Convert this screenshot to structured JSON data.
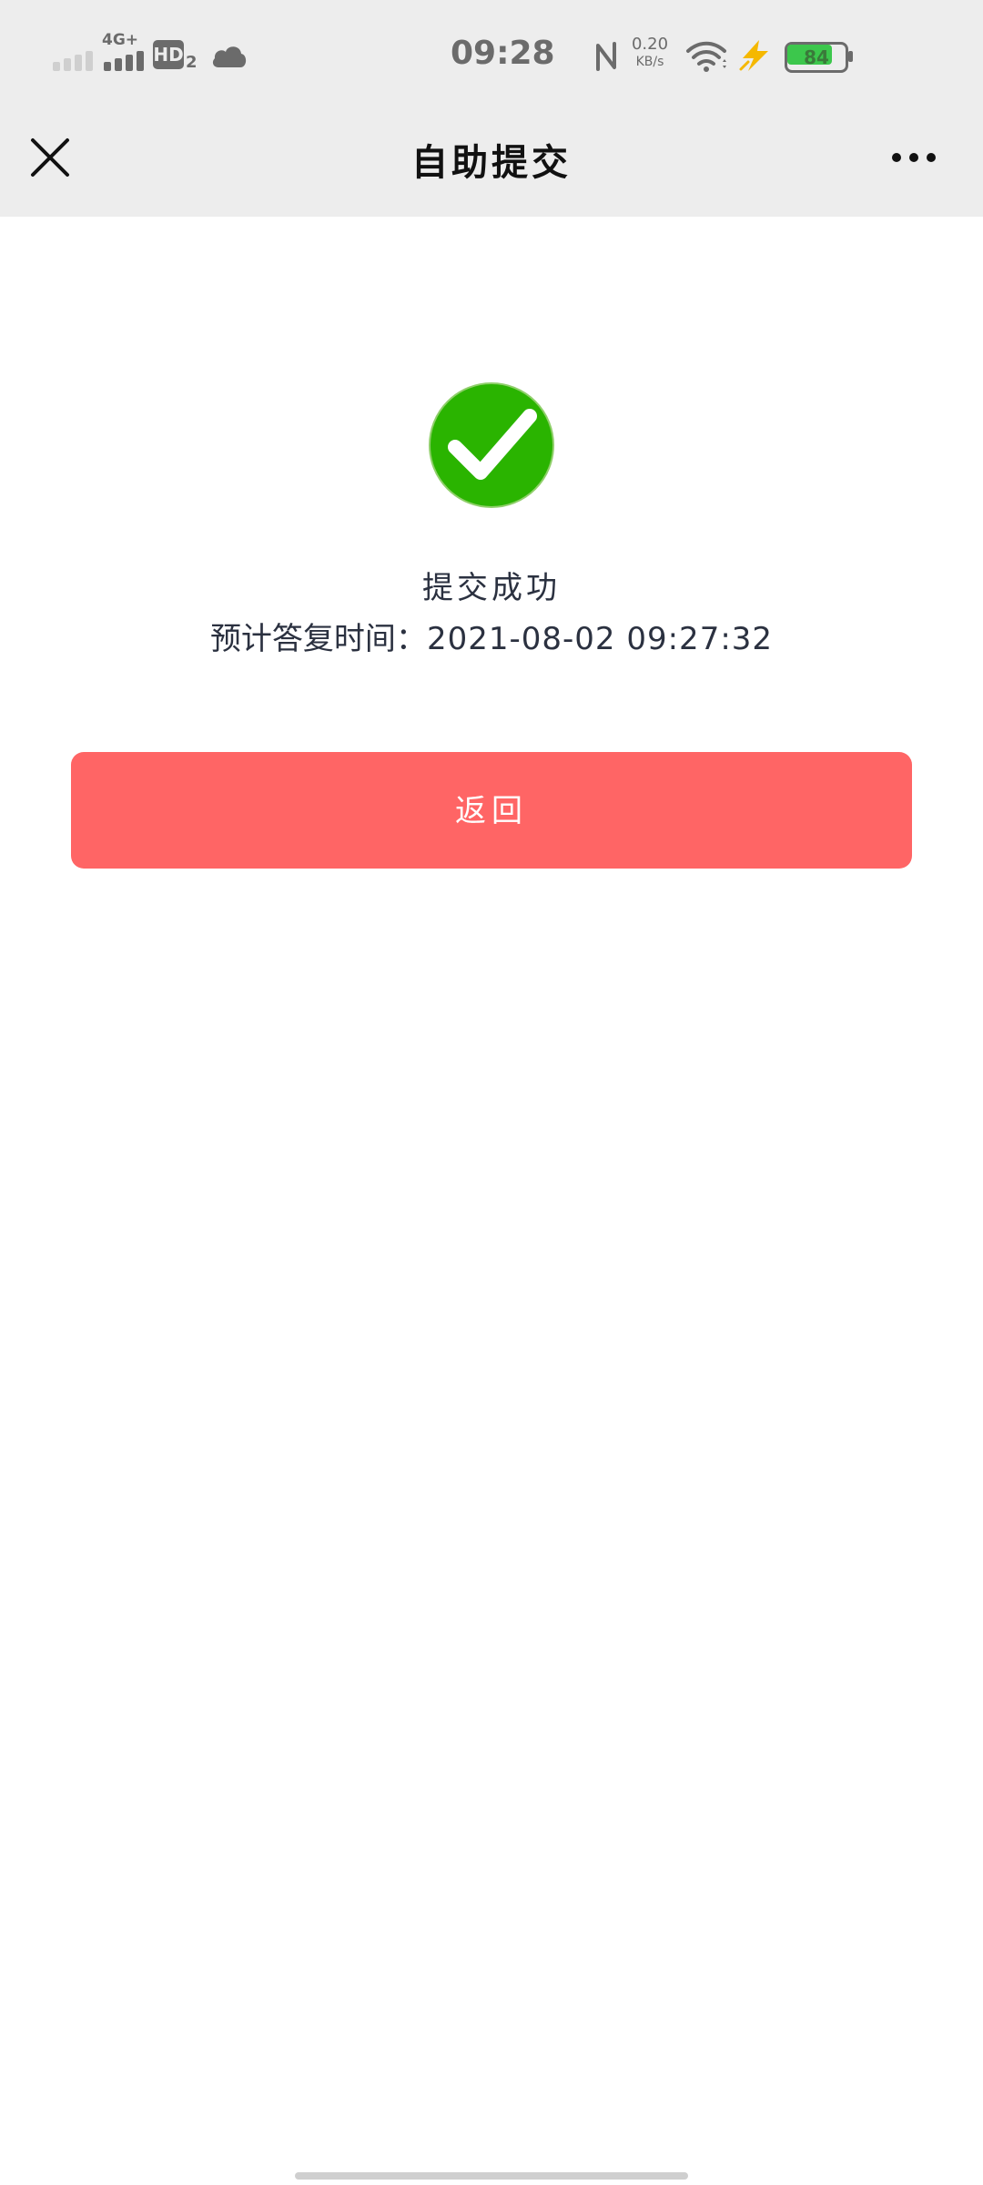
{
  "status_bar": {
    "network": "4G+",
    "hd_label": "HD",
    "hd_sub": "2",
    "time": "09:28",
    "speed_value": "0.20",
    "speed_unit": "KB/s",
    "battery": "84",
    "battery_level": 0.84,
    "battery_color": "#3cc74c"
  },
  "nav": {
    "title": "自助提交",
    "close_icon": "close-icon",
    "more_icon": "more-icon"
  },
  "result": {
    "icon": "check-circle-icon",
    "icon_color": "#2ab400",
    "title": "提交成功",
    "reply_label": "预计答复时间：",
    "reply_value": "2021-08-02 09:27:32"
  },
  "actions": {
    "back_label": "返回",
    "back_color": "#ff6565"
  }
}
